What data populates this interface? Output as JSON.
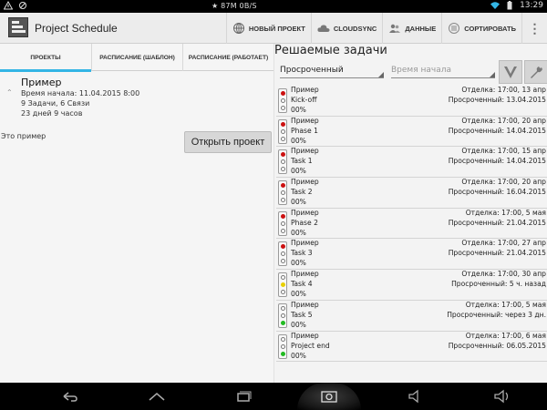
{
  "status_bar": {
    "center_text": "★ 87M  0B/S",
    "time": "13:29",
    "icons": [
      "alert-icon",
      "sync-icon",
      "wifi-icon",
      "battery-icon"
    ]
  },
  "action_bar": {
    "title": "Project Schedule",
    "actions": [
      {
        "label": "НОВЫЙ ПРОЕКТ",
        "icon": "globe-plus-icon"
      },
      {
        "label": "CLOUDSYNC",
        "icon": "cloud-icon"
      },
      {
        "label": "ДАННЫЕ",
        "icon": "people-icon"
      },
      {
        "label": "СОРТИРОВАТЬ",
        "icon": "sort-icon"
      }
    ],
    "overflow": "⋮"
  },
  "left_panel": {
    "tabs": [
      {
        "label": "ПРОЕКТЫ",
        "active": true
      },
      {
        "label": "РАСПИСАНИЕ (ШАБЛОН)",
        "active": false
      },
      {
        "label": "РАСПИСАНИЕ (РАБОТАЕТ)",
        "active": false
      }
    ],
    "project": {
      "name": "Пример",
      "start": "Время начала: 11.04.2015 8:00",
      "counts": "9 Задачи, 6 Связи",
      "duration": "23 дней 9 часов",
      "description": "Это пример"
    },
    "open_button": "Открыть проект"
  },
  "right_panel": {
    "title": "Решаемые задачи",
    "filter_value": "Просроченный",
    "sort_placeholder": "Время начала",
    "tasks": [
      {
        "owner": "Пример",
        "name": "Kick-off",
        "percent": "00%",
        "finish": "Отделка: 17:00, 13 апр",
        "status": "Просроченный: 13.04.2015",
        "light": "red"
      },
      {
        "owner": "Пример",
        "name": "Phase 1",
        "percent": "00%",
        "finish": "Отделка: 17:00, 20 апр",
        "status": "Просроченный: 14.04.2015",
        "light": "red"
      },
      {
        "owner": "Пример",
        "name": "Task 1",
        "percent": "00%",
        "finish": "Отделка: 17:00, 15 апр",
        "status": "Просроченный: 14.04.2015",
        "light": "red"
      },
      {
        "owner": "Пример",
        "name": "Task 2",
        "percent": "00%",
        "finish": "Отделка: 17:00, 20 апр",
        "status": "Просроченный: 16.04.2015",
        "light": "red"
      },
      {
        "owner": "Пример",
        "name": "Phase 2",
        "percent": "00%",
        "finish": "Отделка: 17:00, 5 мая",
        "status": "Просроченный: 21.04.2015",
        "light": "red"
      },
      {
        "owner": "Пример",
        "name": "Task 3",
        "percent": "00%",
        "finish": "Отделка: 17:00, 27 апр",
        "status": "Просроченный: 21.04.2015",
        "light": "red"
      },
      {
        "owner": "Пример",
        "name": "Task 4",
        "percent": "00%",
        "finish": "Отделка: 17:00, 30 апр",
        "status": "Просроченный: 5 ч. назад",
        "light": "yellow"
      },
      {
        "owner": "Пример",
        "name": "Task 5",
        "percent": "00%",
        "finish": "Отделка: 17:00, 5 мая",
        "status": "Просроченный: через 3 дн.",
        "light": "green"
      },
      {
        "owner": "Пример",
        "name": "Project end",
        "percent": "00%",
        "finish": "Отделка: 17:00, 6 мая",
        "status": "Просроченный: 06.05.2015",
        "light": "green"
      }
    ]
  },
  "colors": {
    "accent": "#33b5e5",
    "light_red": "#cc1111",
    "light_yellow": "#e8d000",
    "light_green": "#22bb22"
  },
  "nav_bar": {
    "buttons": [
      "back-icon",
      "home-icon",
      "recent-apps-icon",
      "screenshot-icon",
      "volume-down-icon",
      "volume-up-icon"
    ]
  }
}
